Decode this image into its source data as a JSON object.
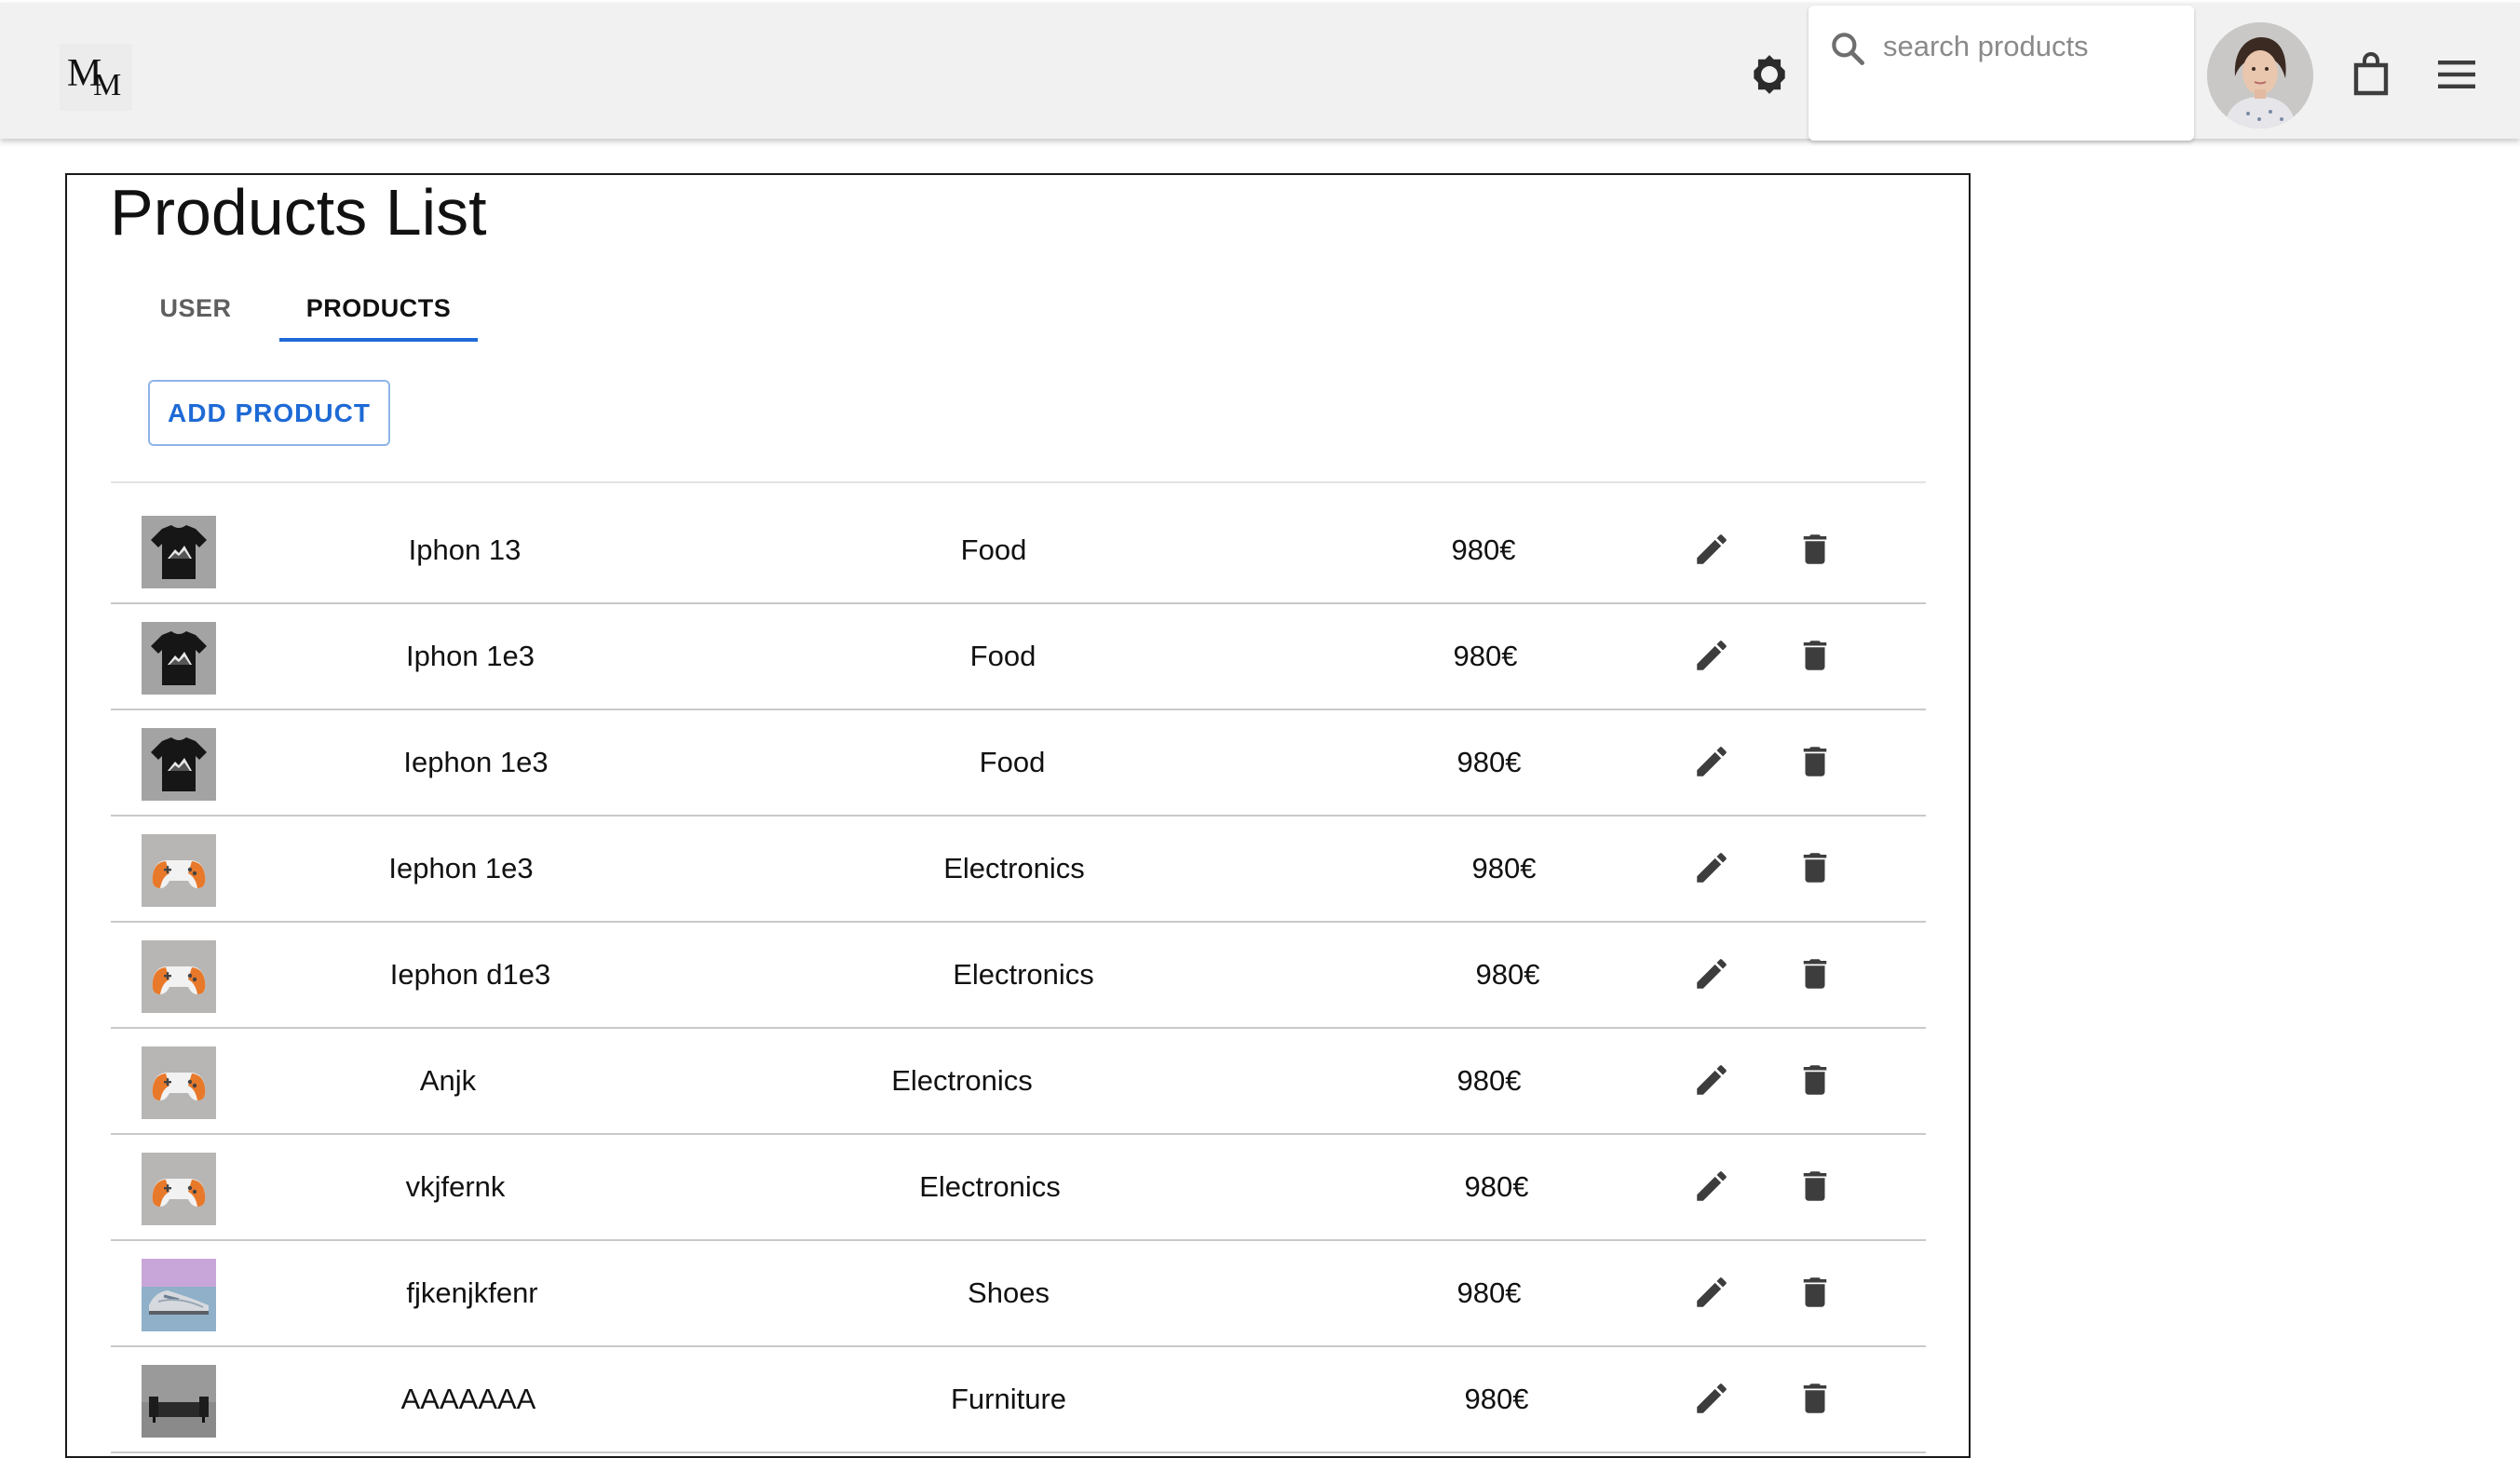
{
  "header": {
    "logo_text": "MM",
    "search": {
      "placeholder": "search products",
      "value": ""
    },
    "icons": [
      "settings-gear-icon",
      "search-icon",
      "user-avatar",
      "shopping-bag-icon",
      "menu-icon"
    ]
  },
  "page": {
    "title": "Products List"
  },
  "tabs": [
    {
      "label": "USER",
      "active": false
    },
    {
      "label": "PRODUCTS",
      "active": true
    }
  ],
  "actions": {
    "add_product_label": "ADD PRODUCT"
  },
  "colors": {
    "accent": "#1e6ad6",
    "appbar": "#f1f1f1",
    "icon": "#3d3d3d"
  },
  "products": [
    {
      "name": "Iphon 13",
      "category": "Food",
      "price": "980€",
      "thumbnail": "black-tshirt"
    },
    {
      "name": "Iphon 1e3",
      "category": "Food",
      "price": "980€",
      "thumbnail": "black-tshirt"
    },
    {
      "name": "Iephon 1e3",
      "category": "Food",
      "price": "980€",
      "thumbnail": "black-tshirt"
    },
    {
      "name": "Iephon 1e3",
      "category": "Electronics",
      "price": "980€",
      "thumbnail": "game-controller"
    },
    {
      "name": "Iephon d1e3",
      "category": "Electronics",
      "price": "980€",
      "thumbnail": "game-controller"
    },
    {
      "name": "Anjk",
      "category": "Electronics",
      "price": "980€",
      "thumbnail": "game-controller"
    },
    {
      "name": "vkjfernk",
      "category": "Electronics",
      "price": "980€",
      "thumbnail": "game-controller"
    },
    {
      "name": "fjkenjkfenr",
      "category": "Shoes",
      "price": "980€",
      "thumbnail": "sneaker"
    },
    {
      "name": "AAAAAAA",
      "category": "Furniture",
      "price": "980€",
      "thumbnail": "sofa"
    }
  ]
}
